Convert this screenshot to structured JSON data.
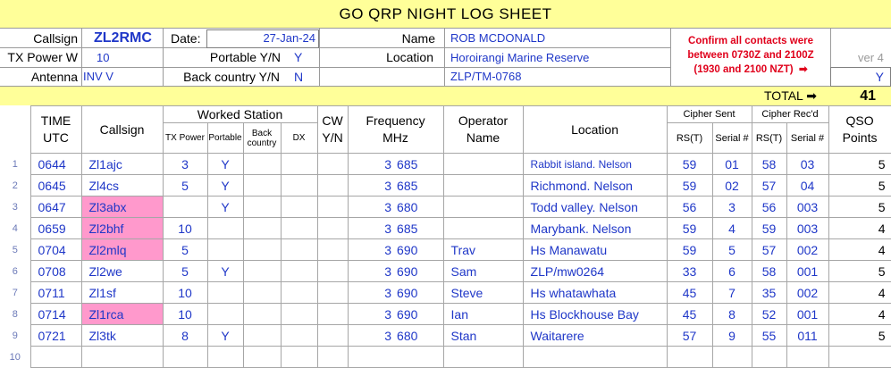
{
  "sheet": {
    "title": "GO  QRP  NIGHT  LOG  SHEET"
  },
  "header": {
    "callsign_label": "Callsign",
    "callsign_value": "ZL2RMC",
    "date_label": "Date:",
    "date_value": "27-Jan-24",
    "name_label": "Name",
    "name_value": "ROB MCDONALD",
    "txpower_label": "TX Power W",
    "txpower_value": "10",
    "portable_label": "Portable Y/N",
    "portable_value": "Y",
    "location_label": "Location",
    "location_value": "Horoirangi Marine Reserve",
    "antenna_label": "Antenna",
    "antenna_value": "INV V",
    "backcountry_label": "Back country Y/N",
    "backcountry_value": "N",
    "ref_value": "ZLP/TM-0768",
    "confirm_line1": "Confirm all contacts were",
    "confirm_line2": "between 0730Z and 2100Z",
    "confirm_line3": "(1930 and 2100 NZT)",
    "confirm_arrow": "➡",
    "version": "ver 4",
    "confirm_value": "Y",
    "total_label": "TOTAL",
    "total_arrow": "➡",
    "total_value": "41"
  },
  "columns": {
    "time1": "TIME",
    "time2": "UTC",
    "callsign": "Callsign",
    "worked": "Worked Station",
    "txpower": "TX Power",
    "portable": "Portable",
    "back1": "Back",
    "back2": "country",
    "dx": "DX",
    "cw1": "CW",
    "cw2": "Y/N",
    "freq1": "Frequency",
    "freq2": "MHz",
    "op1": "Operator",
    "op2": "Name",
    "location": "Location",
    "cipher_sent": "Cipher Sent",
    "cipher_recd": "Cipher Rec'd",
    "rst": "RS(T)",
    "serial": "Serial #",
    "qso1": "QSO",
    "qso2": "Points"
  },
  "rows": [
    {
      "n": "1",
      "time": "0644",
      "call": "Zl1ajc",
      "pink": false,
      "tx": "3",
      "port": "Y",
      "back": "",
      "dx": "",
      "cw": "",
      "mhz": "3",
      "khz": "685",
      "op": "",
      "loc": "Rabbit island. Nelson",
      "loc_small": true,
      "rs_s": "59",
      "ser_s": "01",
      "rs_r": "58",
      "ser_r": "03",
      "pts": "5"
    },
    {
      "n": "2",
      "time": "0645",
      "call": "Zl4cs",
      "pink": false,
      "tx": "5",
      "port": "Y",
      "back": "",
      "dx": "",
      "cw": "",
      "mhz": "3",
      "khz": "685",
      "op": "",
      "loc": "Richmond. Nelson",
      "loc_small": false,
      "rs_s": "59",
      "ser_s": "02",
      "rs_r": "57",
      "ser_r": "04",
      "pts": "5"
    },
    {
      "n": "3",
      "time": "0647",
      "call": "Zl3abx",
      "pink": true,
      "tx": "",
      "port": "Y",
      "back": "",
      "dx": "",
      "cw": "",
      "mhz": "3",
      "khz": "680",
      "op": "",
      "loc": "Todd valley. Nelson",
      "loc_small": false,
      "rs_s": "56",
      "ser_s": "3",
      "rs_r": "56",
      "ser_r": "003",
      "pts": "5"
    },
    {
      "n": "4",
      "time": "0659",
      "call": "Zl2bhf",
      "pink": true,
      "tx": "10",
      "port": "",
      "back": "",
      "dx": "",
      "cw": "",
      "mhz": "3",
      "khz": "685",
      "op": "",
      "loc": "Marybank. Nelson",
      "loc_small": false,
      "rs_s": "59",
      "ser_s": "4",
      "rs_r": "59",
      "ser_r": "003",
      "pts": "4"
    },
    {
      "n": "5",
      "time": "0704",
      "call": "Zl2mlq",
      "pink": true,
      "tx": "5",
      "port": "",
      "back": "",
      "dx": "",
      "cw": "",
      "mhz": "3",
      "khz": "690",
      "op": "Trav",
      "loc": "Hs Manawatu",
      "loc_small": false,
      "rs_s": "59",
      "ser_s": "5",
      "rs_r": "57",
      "ser_r": "002",
      "pts": "4"
    },
    {
      "n": "6",
      "time": "0708",
      "call": "Zl2we",
      "pink": false,
      "tx": "5",
      "port": "Y",
      "back": "",
      "dx": "",
      "cw": "",
      "mhz": "3",
      "khz": "690",
      "op": "Sam",
      "loc": "ZLP/mw0264",
      "loc_small": false,
      "rs_s": "33",
      "ser_s": "6",
      "rs_r": "58",
      "ser_r": "001",
      "pts": "5"
    },
    {
      "n": "7",
      "time": "0711",
      "call": "Zl1sf",
      "pink": false,
      "tx": "10",
      "port": "",
      "back": "",
      "dx": "",
      "cw": "",
      "mhz": "3",
      "khz": "690",
      "op": "Steve",
      "loc": "Hs whatawhata",
      "loc_small": false,
      "rs_s": "45",
      "ser_s": "7",
      "rs_r": "35",
      "ser_r": "002",
      "pts": "4"
    },
    {
      "n": "8",
      "time": "0714",
      "call": "Zl1rca",
      "pink": true,
      "tx": "10",
      "port": "",
      "back": "",
      "dx": "",
      "cw": "",
      "mhz": "3",
      "khz": "690",
      "op": "Ian",
      "loc": "Hs Blockhouse Bay",
      "loc_small": false,
      "rs_s": "45",
      "ser_s": "8",
      "rs_r": "52",
      "ser_r": "001",
      "pts": "4"
    },
    {
      "n": "9",
      "time": "0721",
      "call": "Zl3tk",
      "pink": false,
      "tx": "8",
      "port": "Y",
      "back": "",
      "dx": "",
      "cw": "",
      "mhz": "3",
      "khz": "680",
      "op": "Stan",
      "loc": "Waitarere",
      "loc_small": false,
      "rs_s": "57",
      "ser_s": "9",
      "rs_r": "55",
      "ser_r": "011",
      "pts": "5"
    },
    {
      "n": "10",
      "time": "",
      "call": "",
      "pink": false,
      "tx": "",
      "port": "",
      "back": "",
      "dx": "",
      "cw": "",
      "mhz": "",
      "khz": "",
      "op": "",
      "loc": "",
      "loc_small": false,
      "rs_s": "",
      "ser_s": "",
      "rs_r": "",
      "ser_r": "",
      "pts": ""
    }
  ]
}
